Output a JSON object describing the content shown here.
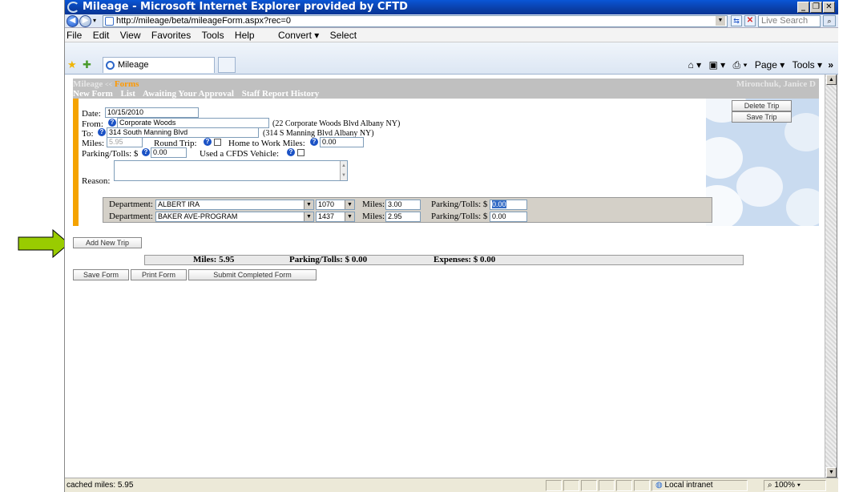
{
  "window": {
    "title": "Mileage - Microsoft Internet Explorer provided by CFTD",
    "controls": {
      "minimize": "_",
      "maximize": "❐",
      "close": "✕"
    }
  },
  "address": {
    "url": "http://mileage/beta/mileageForm.aspx?rec=0",
    "search_placeholder": "Live Search"
  },
  "menu": [
    "File",
    "Edit",
    "View",
    "Favorites",
    "Tools",
    "Help",
    "Convert ▾",
    "Select"
  ],
  "tab": {
    "label": "Mileage"
  },
  "command_bar": {
    "page": "Page ▾",
    "tools": "Tools ▾"
  },
  "app": {
    "breadcrumb_root": "Mileage",
    "breadcrumb_sep": "<<",
    "breadcrumb_active": "Forms",
    "user": "Mironchuk, Janice D",
    "nav": [
      "New Form",
      "List",
      "Awaiting Your Approval",
      "Staff Report History"
    ]
  },
  "trip": {
    "date_label": "Date:",
    "date": "10/15/2010",
    "from_label": "From:",
    "from": "Corporate Woods",
    "from_address": "(22 Corporate Woods Blvd Albany NY)",
    "to_label": "To:",
    "to": "314 South Manning Blvd",
    "to_address": "(314 S Manning Blvd Albany NY)",
    "miles_label": "Miles:",
    "miles": "5.95",
    "round_trip_label": "Round Trip:",
    "home_to_work_label": "Home to Work Miles:",
    "home_to_work": "0.00",
    "parking_label": "Parking/Tolls: $",
    "parking": "0.00",
    "cfds_label": "Used a CFDS Vehicle:",
    "reason_label": "Reason:",
    "reason": "",
    "delete_trip": "Delete Trip",
    "save_trip": "Save Trip"
  },
  "departments": [
    {
      "label": "Department:",
      "name": "ALBERT IRA",
      "code": "1070",
      "miles_label": "Miles:",
      "miles": "3.00",
      "parking_label": "Parking/Tolls: $",
      "parking": "0.00"
    },
    {
      "label": "Department:",
      "name": "BAKER AVE-PROGRAM",
      "code": "1437",
      "miles_label": "Miles:",
      "miles": "2.95",
      "parking_label": "Parking/Tolls: $",
      "parking": "0.00"
    }
  ],
  "actions": {
    "add_trip": "Add New Trip",
    "save_form": "Save Form",
    "print_form": "Print Form",
    "submit_form": "Submit Completed Form"
  },
  "totals": {
    "miles": "Miles: 5.95",
    "parking": "Parking/Tolls: $ 0.00",
    "expenses": "Expenses: $ 0.00"
  },
  "status": {
    "text": "cached miles: 5.95",
    "zone": "Local intranet",
    "zoom": "100%"
  },
  "annotation_colors": {
    "green_arrow": "#99cc00",
    "yellow_arrow": "#ffff00"
  }
}
